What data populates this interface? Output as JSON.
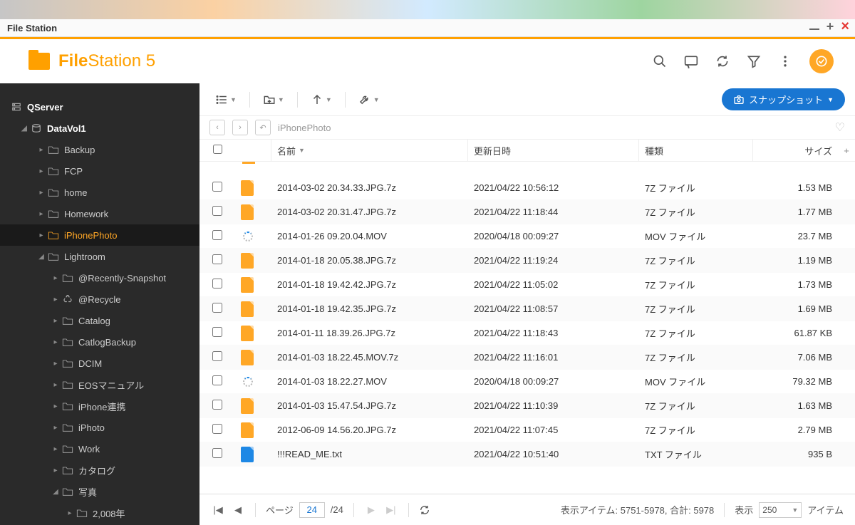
{
  "window_title": "File Station",
  "app_name_bold": "File",
  "app_name_rest": "Station 5",
  "toolbar": {
    "snapshot_label": "スナップショット"
  },
  "breadcrumb": "iPhonePhoto",
  "sidebar": {
    "root": "QServer",
    "volume": "DataVol1",
    "items": [
      {
        "label": "Backup"
      },
      {
        "label": "FCP"
      },
      {
        "label": "home"
      },
      {
        "label": "Homework"
      },
      {
        "label": "iPhonePhoto",
        "selected": true
      },
      {
        "label": "Lightroom",
        "expanded": true,
        "children": [
          {
            "label": "@Recently-Snapshot",
            "icon": "folder"
          },
          {
            "label": "@Recycle",
            "icon": "recycle"
          },
          {
            "label": "Catalog",
            "icon": "folder"
          },
          {
            "label": "CatlogBackup",
            "icon": "folder"
          },
          {
            "label": "DCIM",
            "icon": "folder"
          },
          {
            "label": "EOSマニュアル",
            "icon": "folder"
          },
          {
            "label": "iPhone連携",
            "icon": "folder"
          },
          {
            "label": "iPhoto",
            "icon": "folder"
          },
          {
            "label": "Work",
            "icon": "folder"
          },
          {
            "label": "カタログ",
            "icon": "folder"
          },
          {
            "label": "写真",
            "icon": "folder",
            "expanded": true,
            "children": [
              {
                "label": "2,008年"
              }
            ]
          }
        ]
      }
    ]
  },
  "columns": {
    "name": "名前",
    "date": "更新日時",
    "type": "種類",
    "size": "サイズ"
  },
  "files": [
    {
      "name": "2014-03-02 20.34.33.JPG.7z",
      "date": "2021/04/22 10:56:12",
      "type": "7Z ファイル",
      "size": "1.53 MB",
      "icon": "f7z"
    },
    {
      "name": "2014-03-02 20.31.47.JPG.7z",
      "date": "2021/04/22 11:18:44",
      "type": "7Z ファイル",
      "size": "1.77 MB",
      "icon": "f7z"
    },
    {
      "name": "2014-01-26 09.20.04.MOV",
      "date": "2020/04/18 00:09:27",
      "type": "MOV ファイル",
      "size": "23.7 MB",
      "icon": "fmov"
    },
    {
      "name": "2014-01-18 20.05.38.JPG.7z",
      "date": "2021/04/22 11:19:24",
      "type": "7Z ファイル",
      "size": "1.19 MB",
      "icon": "f7z"
    },
    {
      "name": "2014-01-18 19.42.42.JPG.7z",
      "date": "2021/04/22 11:05:02",
      "type": "7Z ファイル",
      "size": "1.73 MB",
      "icon": "f7z"
    },
    {
      "name": "2014-01-18 19.42.35.JPG.7z",
      "date": "2021/04/22 11:08:57",
      "type": "7Z ファイル",
      "size": "1.69 MB",
      "icon": "f7z"
    },
    {
      "name": "2014-01-11 18.39.26.JPG.7z",
      "date": "2021/04/22 11:18:43",
      "type": "7Z ファイル",
      "size": "61.87 KB",
      "icon": "f7z"
    },
    {
      "name": "2014-01-03 18.22.45.MOV.7z",
      "date": "2021/04/22 11:16:01",
      "type": "7Z ファイル",
      "size": "7.06 MB",
      "icon": "f7z"
    },
    {
      "name": "2014-01-03 18.22.27.MOV",
      "date": "2020/04/18 00:09:27",
      "type": "MOV ファイル",
      "size": "79.32 MB",
      "icon": "fmov"
    },
    {
      "name": "2014-01-03 15.47.54.JPG.7z",
      "date": "2021/04/22 11:10:39",
      "type": "7Z ファイル",
      "size": "1.63 MB",
      "icon": "f7z"
    },
    {
      "name": "2012-06-09 14.56.20.JPG.7z",
      "date": "2021/04/22 11:07:45",
      "type": "7Z ファイル",
      "size": "2.79 MB",
      "icon": "f7z"
    },
    {
      "name": "!!!READ_ME.txt",
      "date": "2021/04/22 10:51:40",
      "type": "TXT ファイル",
      "size": "935 B",
      "icon": "ftxt"
    }
  ],
  "status": {
    "page_label": "ページ",
    "current_page": "24",
    "total_pages": "/24",
    "items_text": "表示アイテム: 5751-5978, 合計: 5978",
    "display_label": "表示",
    "page_size": "250",
    "items_suffix": "アイテム"
  }
}
